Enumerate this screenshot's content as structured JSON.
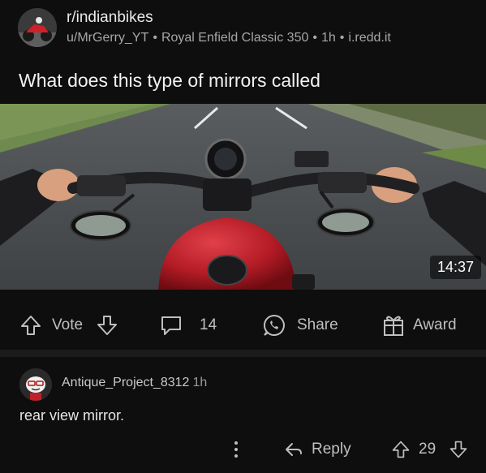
{
  "post": {
    "subreddit": "r/indianbikes",
    "author": "u/MrGerry_YT",
    "flair": "Royal Enfield Classic 350",
    "age": "1h",
    "domain": "i.redd.it",
    "separator": "•",
    "title": "What does this type of mirrors called",
    "media": {
      "duration": "14:37",
      "subject": "motorcycle-pov-road"
    }
  },
  "actions": {
    "vote_label": "Vote",
    "comments_count": "14",
    "share_label": "Share",
    "award_label": "Award",
    "icons": [
      "upvote-arrow-icon",
      "downvote-arrow-icon",
      "comment-bubble-icon",
      "whatsapp-share-icon",
      "gift-award-icon"
    ]
  },
  "comment": {
    "author": "Antique_Project_8312",
    "age": "1h",
    "body": "rear view mirror.",
    "reply_label": "Reply",
    "score": "29",
    "icons": [
      "more-options-icon",
      "reply-arrow-icon",
      "upvote-arrow-icon",
      "downvote-arrow-icon"
    ]
  },
  "colors": {
    "background": "#0e0e0e",
    "divider": "#1b1b1b",
    "text_primary": "#f2f2f2",
    "text_secondary": "#a7a7a7",
    "tank_red": "#c0202a"
  }
}
